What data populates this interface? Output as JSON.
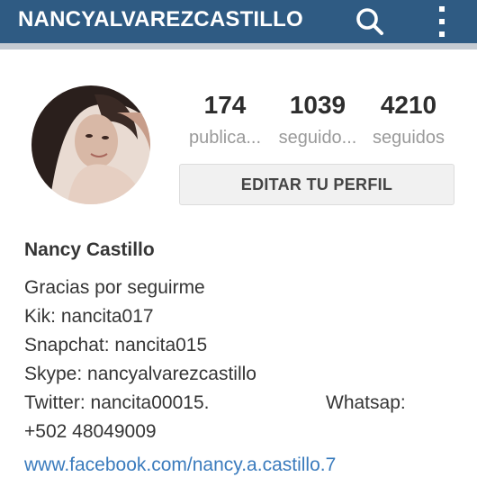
{
  "header": {
    "username": "NANCYALVAREZCASTILLO",
    "search_icon": "search-icon",
    "more_icon": "more-vertical-icon",
    "background_color": "#2f5b83"
  },
  "profile": {
    "stats": [
      {
        "value": "174",
        "label": "publica..."
      },
      {
        "value": "1039",
        "label": "seguido..."
      },
      {
        "value": "4210",
        "label": "seguidos"
      }
    ],
    "edit_button_label": "EDITAR TU PERFIL",
    "full_name": "Nancy Castillo",
    "bio_lines": [
      "Gracias por seguirme",
      "Kik: nancita017",
      "Snapchat: nancita015",
      "Skype: nancyalvarezcastillo",
      "Twitter: nancita00015.",
      "+502 48049009"
    ],
    "bio_whatsapp_label": "Whatsap:",
    "website": "www.facebook.com/nancy.a.castillo.7",
    "link_color": "#3a7bbd"
  }
}
